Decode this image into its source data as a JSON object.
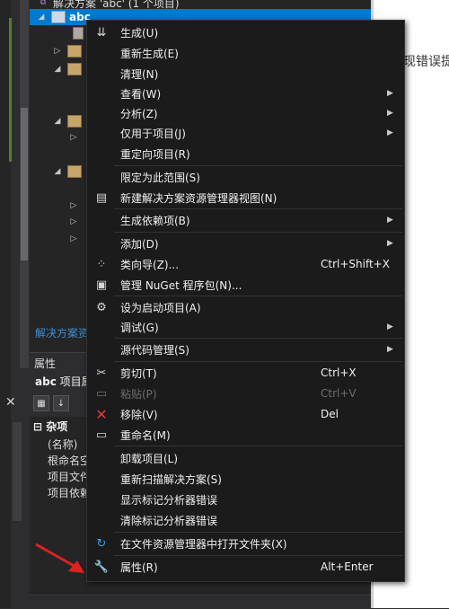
{
  "solution_explorer": {
    "title_row": "解决方案 'abc' (1 个项目)",
    "project_label": "abc",
    "footer_tab": "解决方案资"
  },
  "properties": {
    "header": "属性",
    "object_name": "abc",
    "object_type": "项目属",
    "category": "杂项",
    "rows": [
      "(名称)",
      "根命名空",
      "项目文件",
      "项目依赖"
    ]
  },
  "right_panel": {
    "text": "现错误提"
  },
  "context_menu": {
    "items": [
      {
        "label": "生成(U)",
        "icon": "build-icon"
      },
      {
        "label": "重新生成(E)"
      },
      {
        "label": "清理(N)"
      },
      {
        "label": "查看(W)",
        "submenu": true
      },
      {
        "label": "分析(Z)",
        "submenu": true
      },
      {
        "label": "仅用于项目(J)",
        "submenu": true
      },
      {
        "label": "重定向项目(R)"
      },
      {
        "label": "限定为此范围(S)"
      },
      {
        "label": "新建解决方案资源管理器视图(N)",
        "icon": "new-view-icon"
      },
      {
        "label": "生成依赖项(B)",
        "submenu": true
      },
      {
        "label": "添加(D)",
        "submenu": true
      },
      {
        "label": "类向导(Z)...",
        "shortcut": "Ctrl+Shift+X",
        "icon": "class-wizard-icon"
      },
      {
        "label": "管理 NuGet 程序包(N)...",
        "icon": "nuget-icon"
      },
      {
        "label": "设为启动项目(A)",
        "icon": "gear-icon"
      },
      {
        "label": "调试(G)",
        "submenu": true
      },
      {
        "label": "源代码管理(S)",
        "submenu": true
      },
      {
        "label": "剪切(T)",
        "shortcut": "Ctrl+X",
        "icon": "scissors-icon"
      },
      {
        "label": "粘贴(P)",
        "shortcut": "Ctrl+V",
        "icon": "paste-icon",
        "disabled": true
      },
      {
        "label": "移除(V)",
        "shortcut": "Del",
        "icon": "remove-icon"
      },
      {
        "label": "重命名(M)",
        "icon": "rename-icon"
      },
      {
        "label": "卸载项目(L)"
      },
      {
        "label": "重新扫描解决方案(S)"
      },
      {
        "label": "显示标记分析器错误"
      },
      {
        "label": "清除标记分析器错误"
      },
      {
        "label": "在文件资源管理器中打开文件夹(X)",
        "icon": "refresh-folder-icon"
      },
      {
        "label": "属性(R)",
        "shortcut": "Alt+Enter",
        "icon": "wrench-icon"
      }
    ]
  },
  "colors": {
    "accent": "#007acc",
    "menu_bg": "#1b1b1c",
    "remove_icon": "#e03c3c",
    "arrow": "#e02020"
  }
}
